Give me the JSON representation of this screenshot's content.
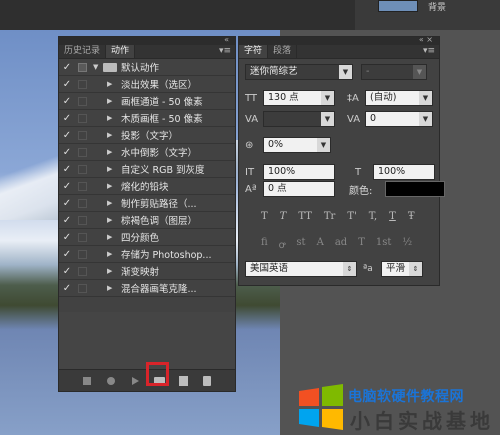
{
  "topbar": {
    "layer_label": "背景"
  },
  "actions_panel": {
    "tabs": [
      "历史记录",
      "动作"
    ],
    "default_set": "默认动作",
    "items": [
      "淡出效果（选区）",
      "画框通道 - 50 像素",
      "木质画框 - 50 像素",
      "投影（文字）",
      "水中倒影（文字）",
      "自定义 RGB 到灰度",
      "熔化的铅块",
      "制作剪贴路径（...",
      "棕褐色调（图层）",
      "四分颜色",
      "存储为 Photoshop...",
      "渐变映射",
      "混合器画笔克隆..."
    ],
    "footer_icons": [
      "stop-icon",
      "record-icon",
      "play-icon",
      "new-set-folder-icon",
      "new-action-icon",
      "delete-icon"
    ]
  },
  "char_panel": {
    "tabs": [
      "字符",
      "段落"
    ],
    "font_family": "迷你简综艺",
    "font_style": "-",
    "font_size": "130 点",
    "leading": "(自动)",
    "kerning": "",
    "tracking": "0",
    "tsume": "0%",
    "vscale": "100%",
    "hscale": "100%",
    "baseline": "0 点",
    "color_label": "颜色:",
    "color_value": "#000000",
    "style_glyphs": [
      "T",
      "T",
      "TT",
      "Tr",
      "T'",
      "T,",
      "T",
      "Ŧ"
    ],
    "opentype_glyphs": [
      "fi",
      "ꝍ",
      "st",
      "A",
      "ad",
      "T",
      "1st",
      "½"
    ],
    "language": "美国英语",
    "aa_label": "ªa",
    "antialias": "平滑"
  },
  "watermark": {
    "line1": "电脑软硬件教程网",
    "line2": "小白实战基地"
  }
}
